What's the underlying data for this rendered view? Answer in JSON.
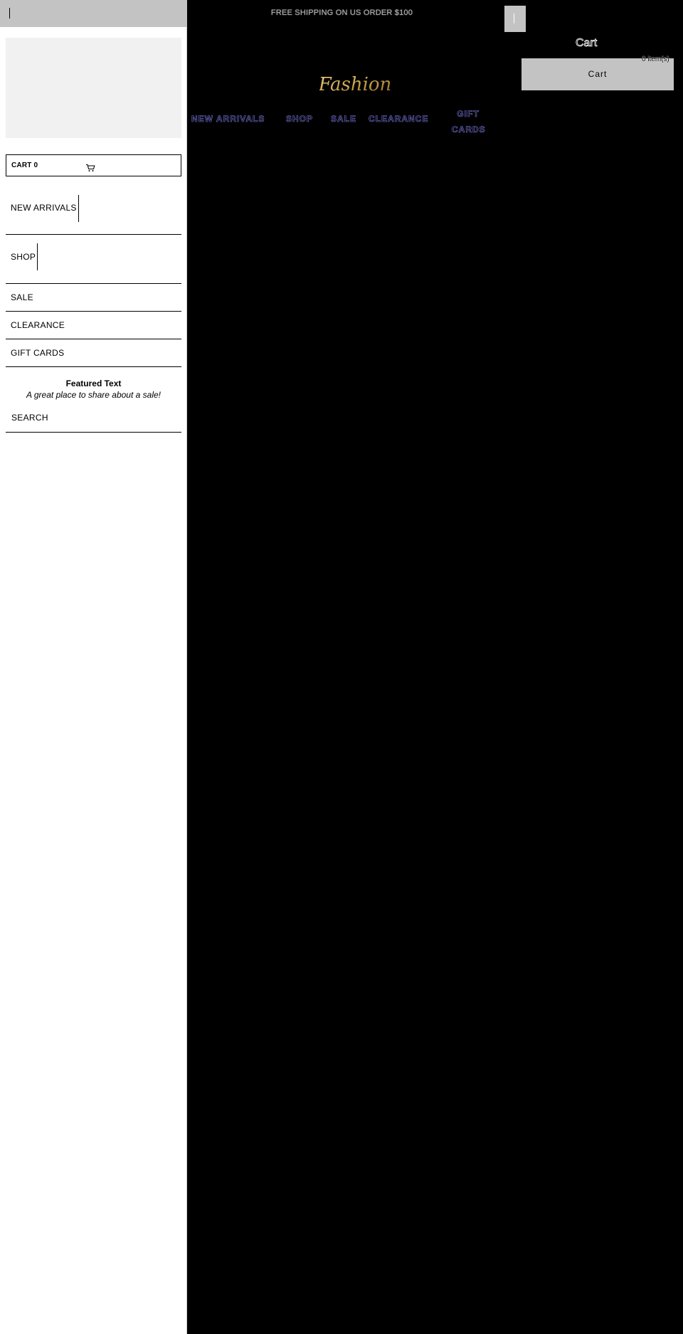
{
  "announcement": "FREE SHIPPING ON US ORDER $100",
  "header": {
    "logo_text": "Fashion",
    "cart_heading": "Cart",
    "cart_button_label": "Cart",
    "cart_count": "0 item(s)"
  },
  "main_nav": [
    {
      "label": "NEW ARRIVALS"
    },
    {
      "label": "SHOP"
    },
    {
      "label": "SALE"
    },
    {
      "label": "CLEARANCE"
    },
    {
      "label_line1": "GIFT",
      "label_line2": "CARDS"
    }
  ],
  "sidebar": {
    "cart_label": "CART 0",
    "items": [
      {
        "label": "NEW ARRIVALS"
      },
      {
        "label": "SHOP"
      },
      {
        "label": "SALE"
      },
      {
        "label": "CLEARANCE"
      },
      {
        "label": "GIFT CARDS"
      }
    ],
    "featured_title": "Featured Text",
    "featured_subtitle": "A great place to share about a sale!",
    "search_label": "SEARCH"
  },
  "colors": {
    "page_background": "#000000",
    "sidebar_background": "#ffffff",
    "topbar_gray": "#c3c3c3",
    "promo_gray": "#f1f1f1",
    "nav_outline": "#7a78e0",
    "logo_gold": "#c9a24a"
  },
  "icons": {
    "cart": "cart-icon",
    "logo": "fashion-script-logo"
  }
}
